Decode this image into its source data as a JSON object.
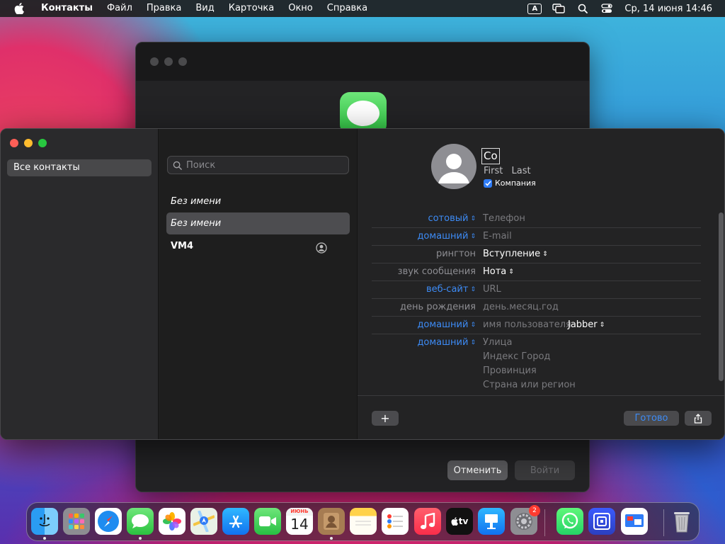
{
  "menubar": {
    "app_name": "Контакты",
    "items": [
      "Файл",
      "Правка",
      "Вид",
      "Карточка",
      "Окно",
      "Справка"
    ],
    "keyboard_indicator": "A",
    "clock": "Ср, 14 июня  14:46"
  },
  "background_window": {
    "cancel_label": "Отменить",
    "login_label": "Войти"
  },
  "sidebar": {
    "items": [
      {
        "label": "Все контакты",
        "selected": true
      }
    ]
  },
  "contact_list": {
    "search_placeholder": "Поиск",
    "contacts": [
      {
        "name": "Без имени",
        "selected": false
      },
      {
        "name": "Без имени",
        "selected": true
      },
      {
        "name": "VM4",
        "selected": false
      }
    ]
  },
  "card": {
    "name_field": "Co",
    "first_placeholder": "First",
    "last_placeholder": "Last",
    "company_label": "Компания",
    "company_checked": true,
    "fields": [
      {
        "label": "сотовый",
        "label_blue": true,
        "value": "Телефон",
        "value_filled": false
      },
      {
        "label": "домашний",
        "label_blue": true,
        "value": "E-mail",
        "value_filled": false
      },
      {
        "label": "рингтон",
        "label_blue": false,
        "value": "Вступление",
        "value_filled": true
      },
      {
        "label": "звук сообщения",
        "label_blue": false,
        "value": "Нота",
        "value_filled": true
      },
      {
        "label": "веб-сайт",
        "label_blue": true,
        "value": "URL",
        "value_filled": false
      },
      {
        "label": "день рождения",
        "label_blue": false,
        "value": "день.месяц.год",
        "value_filled": false
      },
      {
        "label": "домашний",
        "label_blue": true,
        "value": "имя пользователя",
        "value_filled": false,
        "extra": "Jabber"
      }
    ],
    "address": {
      "label": "домашний",
      "lines": [
        "Улица",
        "Индекс Город",
        "Провинция",
        "Страна или регион"
      ]
    },
    "add_label": "+",
    "done_label": "Готово"
  },
  "dock": {
    "calendar_month": "ИЮНЬ",
    "calendar_day": "14",
    "tv_label": "tv",
    "settings_badge": "2"
  },
  "colors": {
    "accent_blue": "#3d8bf5",
    "close": "#fe5f57",
    "minimize": "#febc2e",
    "zoom": "#28c840"
  }
}
